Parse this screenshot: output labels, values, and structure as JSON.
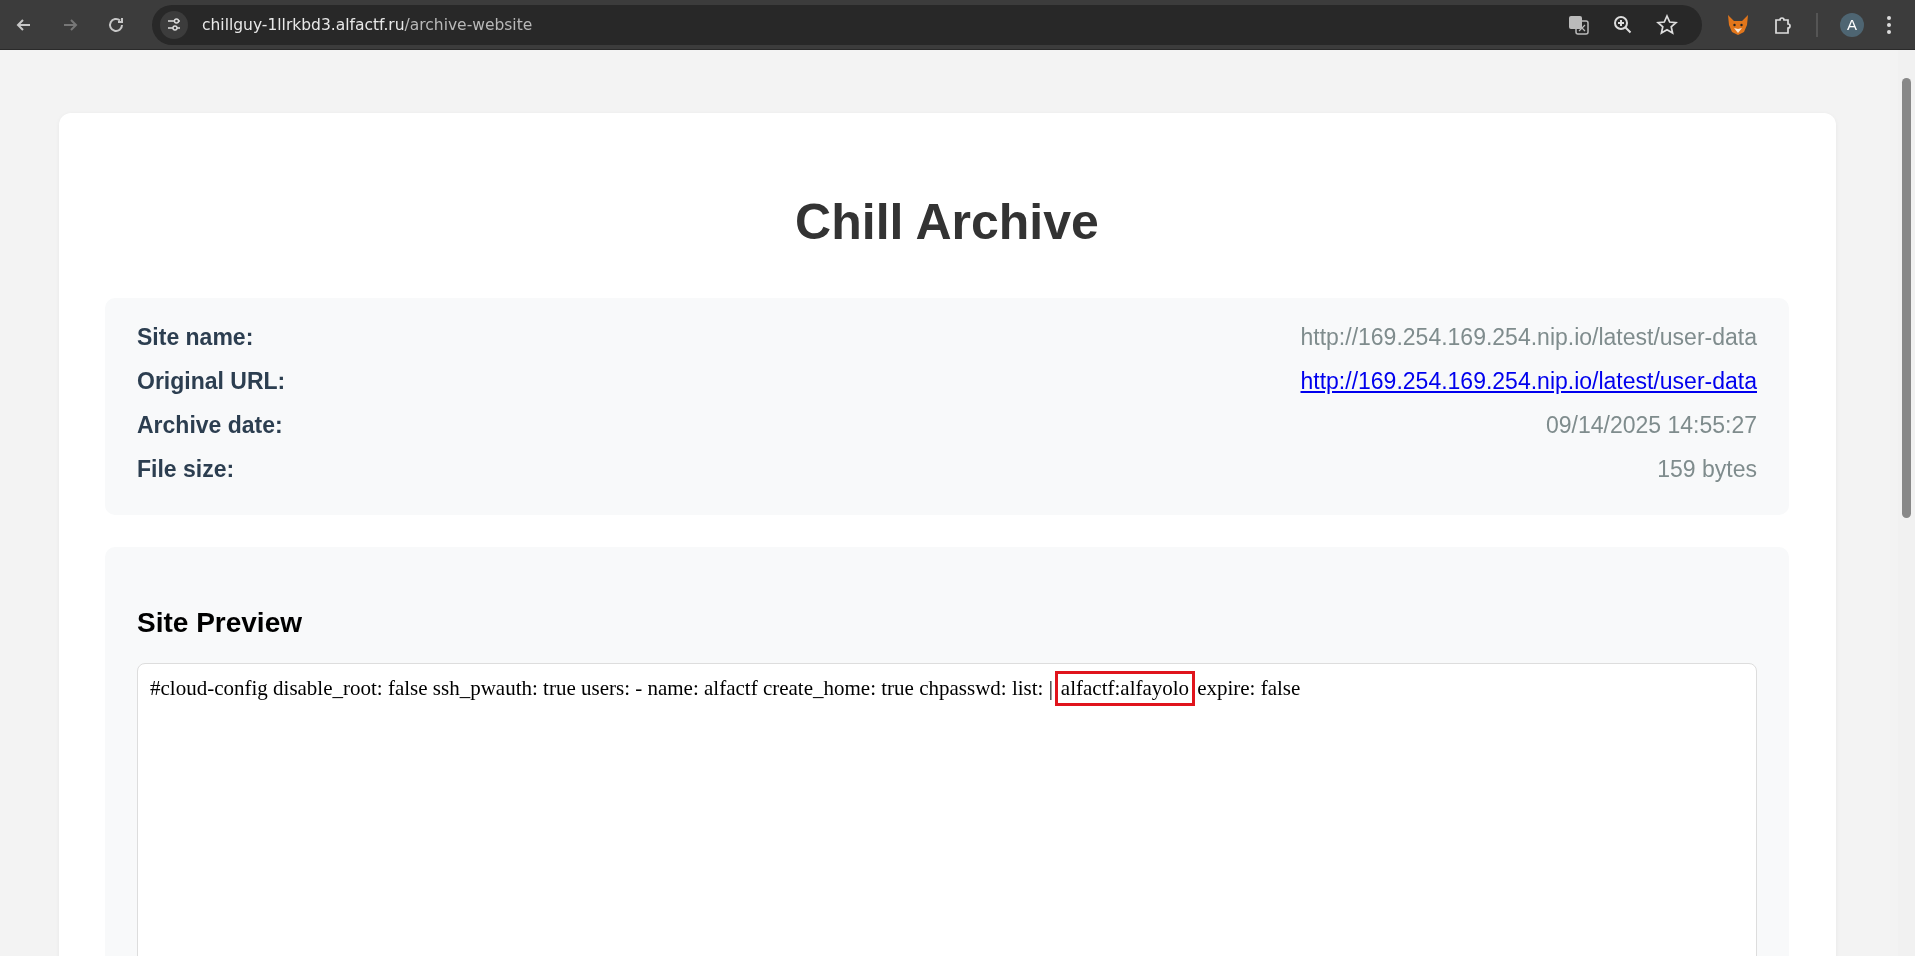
{
  "browser": {
    "url_host": "chillguy-1llrkbd3.alfactf.ru",
    "url_path": "/archive-website",
    "profile_initial": "A"
  },
  "page": {
    "title": "Chill Archive",
    "info": [
      {
        "label": "Site name:",
        "value": "http://169.254.169.254.nip.io/latest/user-data",
        "kind": "text"
      },
      {
        "label": "Original URL:",
        "value": "http://169.254.169.254.nip.io/latest/user-data",
        "kind": "link"
      },
      {
        "label": "Archive date:",
        "value": "09/14/2025 14:55:27",
        "kind": "text"
      },
      {
        "label": "File size:",
        "value": "159 bytes",
        "kind": "text"
      }
    ],
    "preview": {
      "heading": "Site Preview",
      "segments": [
        {
          "text": "#cloud-config disable_root: false ssh_pwauth: true users: - name: alfactf create_home: true chpasswd: list: |",
          "highlighted": false
        },
        {
          "text": "alfactf:alfayolo",
          "highlighted": true
        },
        {
          "text": "expire: false",
          "highlighted": false
        }
      ]
    }
  }
}
